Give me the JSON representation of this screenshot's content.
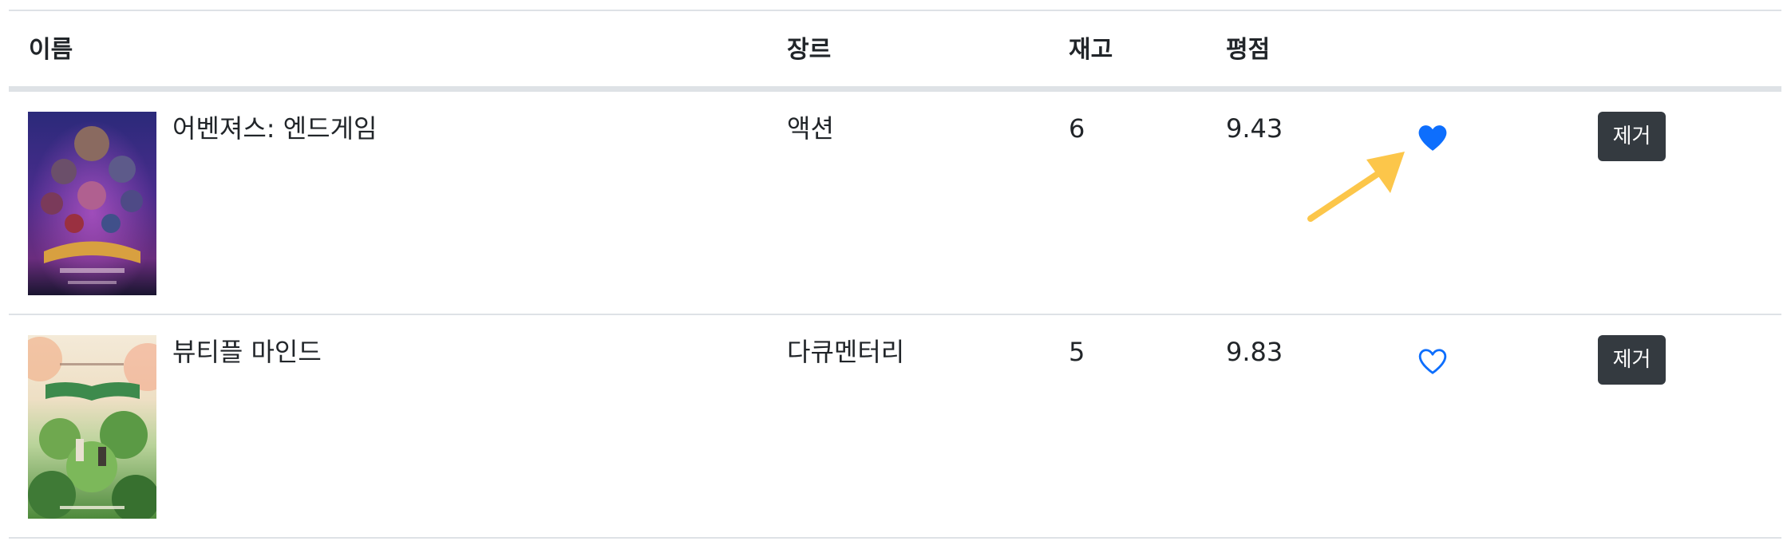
{
  "table": {
    "headers": {
      "name": "이름",
      "genre": "장르",
      "stock": "재고",
      "rating": "평점"
    },
    "rows": [
      {
        "name": "어벤져스: 엔드게임",
        "genre": "액션",
        "stock": "6",
        "rating": "9.43",
        "liked": true,
        "remove_label": "제거",
        "poster_icon": "avengers-poster"
      },
      {
        "name": "뷰티플 마인드",
        "genre": "다큐멘터리",
        "stock": "5",
        "rating": "9.83",
        "liked": false,
        "remove_label": "제거",
        "poster_icon": "beautiful-mind-poster"
      }
    ]
  },
  "colors": {
    "heart": "#0d6efd",
    "arrow": "#fcc64a",
    "button": "#343a40",
    "divider": "#dee2e6"
  }
}
